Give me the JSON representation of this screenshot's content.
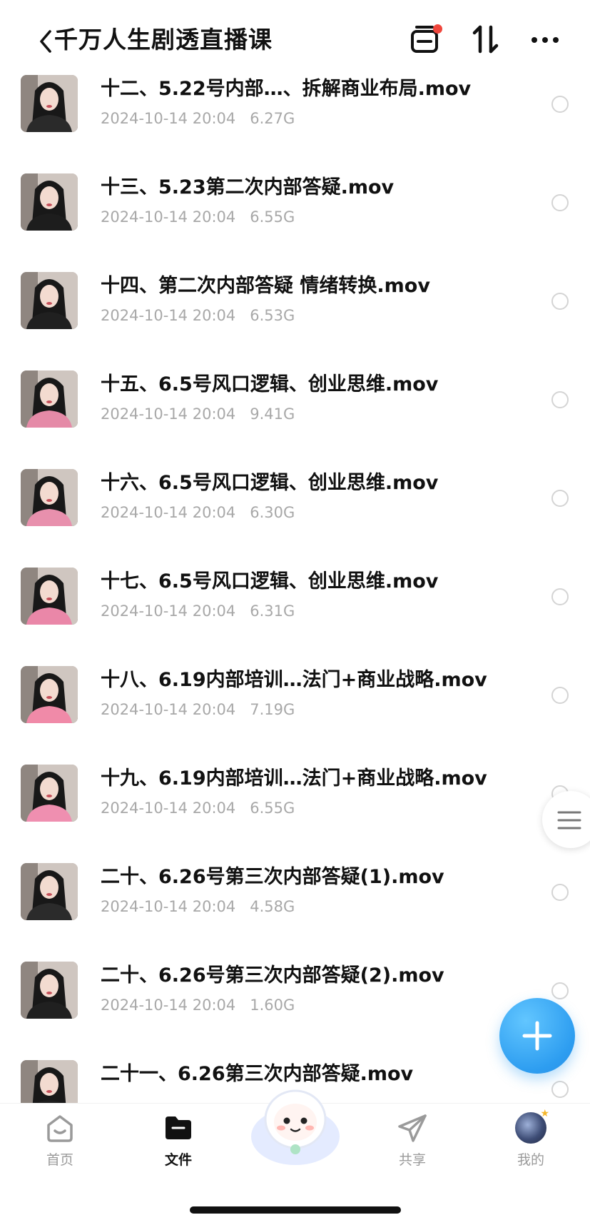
{
  "header": {
    "back_icon": "chevron-left-icon",
    "title": "千万人生剧透直播课",
    "actions": [
      {
        "icon": "transfer-list-icon",
        "has_badge": true
      },
      {
        "icon": "sort-icon"
      },
      {
        "icon": "more-icon"
      }
    ]
  },
  "files": [
    {
      "name": "十二、5.22号内部…、拆解商业布局.mov",
      "date": "2024-10-14 20:04",
      "size": "6.27G"
    },
    {
      "name": "十三、5.23第二次内部答疑.mov",
      "date": "2024-10-14 20:04",
      "size": "6.55G"
    },
    {
      "name": "十四、第二次内部答疑 情绪转换.mov",
      "date": "2024-10-14 20:04",
      "size": "6.53G"
    },
    {
      "name": "十五、6.5号风口逻辑、创业思维.mov",
      "date": "2024-10-14 20:04",
      "size": "9.41G"
    },
    {
      "name": "十六、6.5号风口逻辑、创业思维.mov",
      "date": "2024-10-14 20:04",
      "size": "6.30G"
    },
    {
      "name": "十七、6.5号风口逻辑、创业思维.mov",
      "date": "2024-10-14 20:04",
      "size": "6.31G"
    },
    {
      "name": "十八、6.19内部培训…法门+商业战略.mov",
      "date": "2024-10-14 20:04",
      "size": "7.19G"
    },
    {
      "name": "十九、6.19内部培训…法门+商业战略.mov",
      "date": "2024-10-14 20:04",
      "size": "6.55G"
    },
    {
      "name": "二十、6.26号第三次内部答疑(1).mov",
      "date": "2024-10-14 20:04",
      "size": "4.58G"
    },
    {
      "name": "二十、6.26号第三次内部答疑(2).mov",
      "date": "2024-10-14 20:04",
      "size": "1.60G"
    },
    {
      "name": "二十一、6.26第三次内部答疑.mov",
      "date": "",
      "size": ""
    }
  ],
  "fab": {
    "icon": "plus-icon"
  },
  "side_handle": {
    "icon": "menu-lines-icon"
  },
  "bottom_nav": {
    "items": [
      {
        "label": "首页",
        "icon": "home-icon",
        "active": false
      },
      {
        "label": "文件",
        "icon": "folder-icon",
        "active": true
      },
      {
        "label": "",
        "icon": "mascot-icon",
        "active": false
      },
      {
        "label": "共享",
        "icon": "share-send-icon",
        "active": false
      },
      {
        "label": "我的",
        "icon": "avatar-icon",
        "active": false
      }
    ]
  },
  "colors": {
    "accent": "#2d9df0",
    "badge": "#f0463c",
    "text_primary": "#111111",
    "text_secondary": "#a8a8a8"
  }
}
